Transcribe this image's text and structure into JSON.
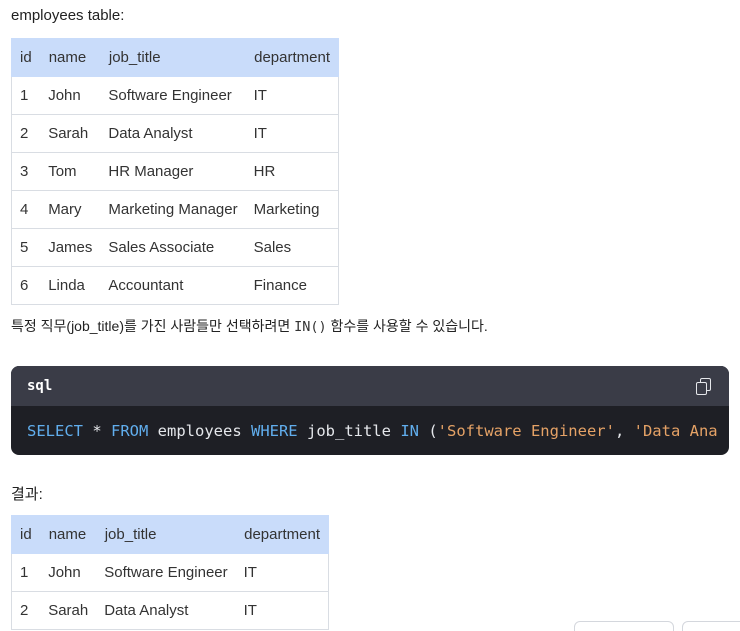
{
  "table1": {
    "caption": "employees table:",
    "headers": [
      "id",
      "name",
      "job_title",
      "department"
    ],
    "rows": [
      [
        "1",
        "John",
        "Software Engineer",
        "IT"
      ],
      [
        "2",
        "Sarah",
        "Data Analyst",
        "IT"
      ],
      [
        "3",
        "Tom",
        "HR Manager",
        "HR"
      ],
      [
        "4",
        "Mary",
        "Marketing Manager",
        "Marketing"
      ],
      [
        "5",
        "James",
        "Sales Associate",
        "Sales"
      ],
      [
        "6",
        "Linda",
        "Accountant",
        "Finance"
      ]
    ]
  },
  "paragraph": {
    "before": "특정 직무(job_title)를 가진 사람들만 선택하려면 ",
    "code": "IN()",
    "after": " 함수를 사용할 수 있습니다."
  },
  "codeblock": {
    "language": "sql",
    "copy_icon": "copy-icon",
    "tokens": [
      {
        "t": "SELECT",
        "k": "kw"
      },
      {
        "t": " * ",
        "k": ""
      },
      {
        "t": "FROM",
        "k": "kw"
      },
      {
        "t": " employees ",
        "k": ""
      },
      {
        "t": "WHERE",
        "k": "kw"
      },
      {
        "t": " job_title ",
        "k": ""
      },
      {
        "t": "IN",
        "k": "kw"
      },
      {
        "t": " (",
        "k": ""
      },
      {
        "t": "'Software Engineer'",
        "k": "str"
      },
      {
        "t": ", ",
        "k": ""
      },
      {
        "t": "'Data Ana",
        "k": "str"
      }
    ]
  },
  "table2": {
    "caption": "결과:",
    "headers": [
      "id",
      "name",
      "job_title",
      "department"
    ],
    "rows": [
      [
        "1",
        "John",
        "Software Engineer",
        "IT"
      ],
      [
        "2",
        "Sarah",
        "Data Analyst",
        "IT"
      ]
    ]
  },
  "colors": {
    "header_bg": "#c9dcfa",
    "code_bg": "#1e1f25",
    "code_header_bg": "#3a3c47",
    "keyword": "#61aeee",
    "string": "#e5a266"
  }
}
